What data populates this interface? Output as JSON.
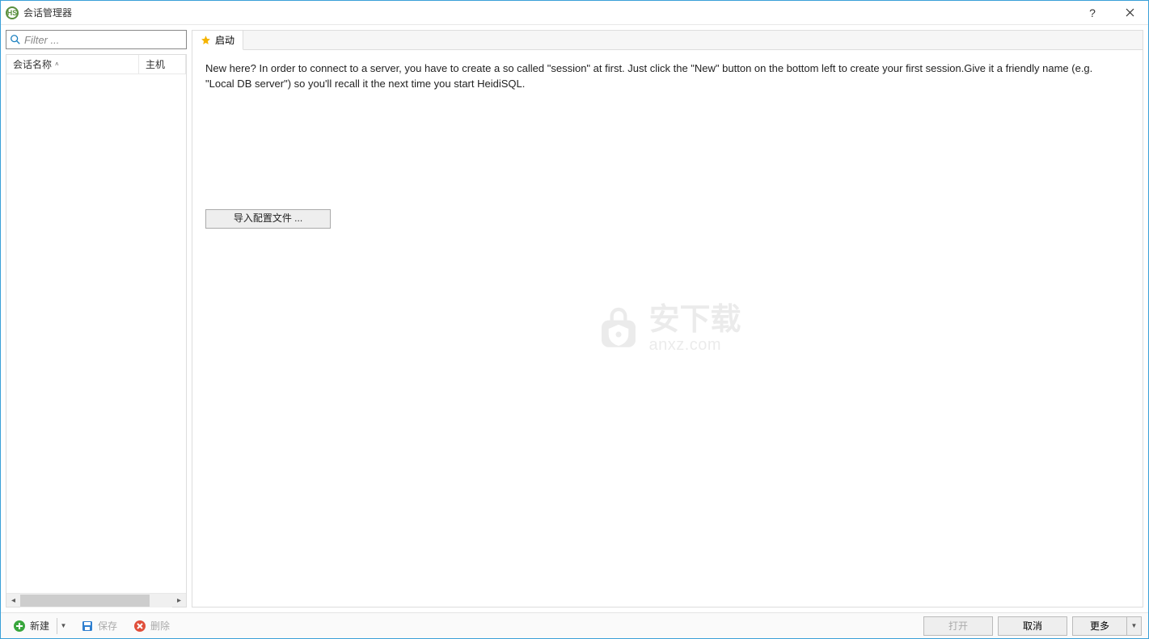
{
  "window": {
    "title": "会话管理器"
  },
  "filter": {
    "placeholder": "Filter ..."
  },
  "list": {
    "col_name": "会话名称",
    "col_host": "主机"
  },
  "tab": {
    "startup": "启动"
  },
  "main": {
    "intro": "New here? In order to connect to a server, you have to create a so called \"session\" at first. Just click the \"New\" button on the bottom left to create your first session.Give it a friendly name (e.g. \"Local DB server\") so you'll recall it the next time you start HeidiSQL.",
    "import_btn": "导入配置文件 ..."
  },
  "watermark": {
    "cn": "安下载",
    "en": "anxz.com"
  },
  "footer": {
    "new": "新建",
    "save": "保存",
    "delete": "删除",
    "open": "打开",
    "cancel": "取消",
    "more": "更多"
  }
}
